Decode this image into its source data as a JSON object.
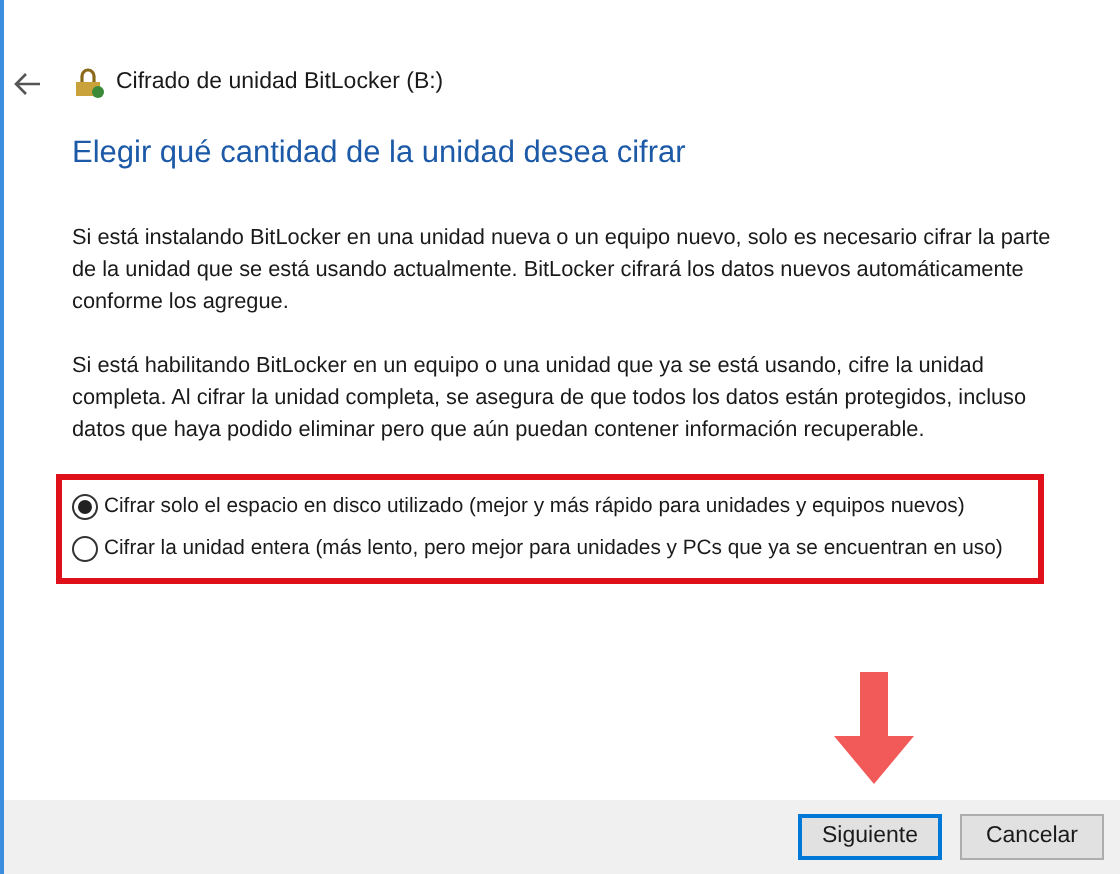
{
  "window": {
    "title": "Cifrado de unidad BitLocker (B:)"
  },
  "heading": "Elegir qué cantidad de la unidad desea cifrar",
  "paragraphs": [
    "Si está instalando BitLocker en una unidad nueva o un equipo nuevo, solo es necesario cifrar la parte de la unidad que se está usando actualmente. BitLocker cifrará los datos nuevos automáticamente conforme los agregue.",
    "Si está habilitando BitLocker en un equipo o una unidad que ya se está usando, cifre la unidad completa. Al cifrar la unidad completa, se asegura de que todos los datos están protegidos, incluso datos que haya podido eliminar pero que aún puedan contener información recuperable."
  ],
  "options": [
    {
      "label": "Cifrar solo el espacio en disco utilizado (mejor y más rápido para unidades y equipos nuevos)",
      "selected": true
    },
    {
      "label": "Cifrar la unidad entera (más lento, pero mejor para unidades y PCs que ya se encuentran en uso)",
      "selected": false
    }
  ],
  "buttons": [
    {
      "label": "Siguiente",
      "default": true
    },
    {
      "label": "Cancelar",
      "default": false
    }
  ]
}
